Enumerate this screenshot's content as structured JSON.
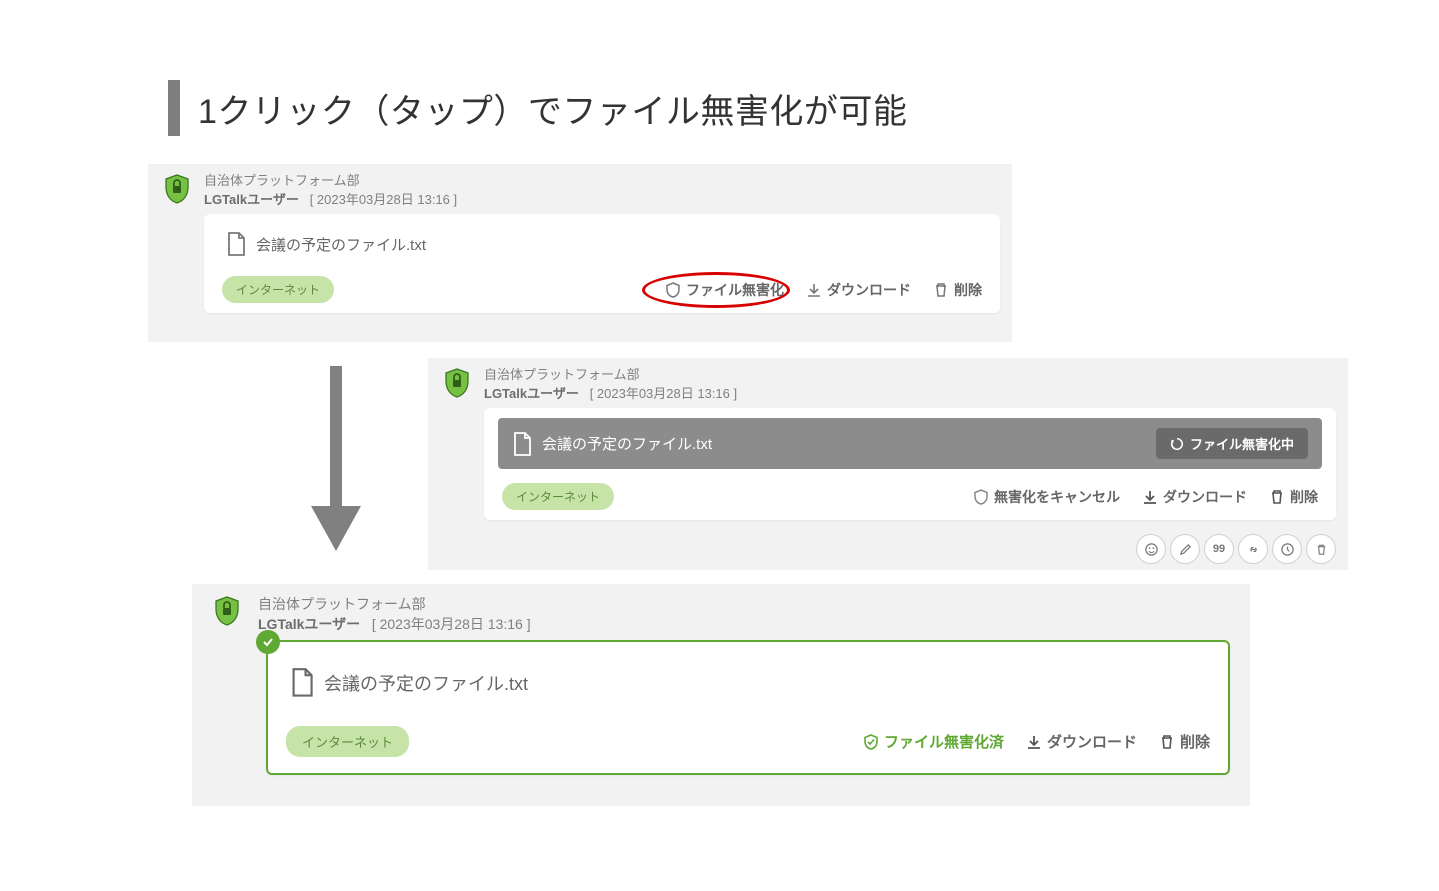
{
  "heading": "1クリック（タップ）でファイル無害化が可能",
  "dept": "自治体プラットフォーム部",
  "user": "LGTalkユーザー",
  "timestamp": "[ 2023年03月28日 13:16 ]",
  "filename": "会議の予定のファイル.txt",
  "badge": "インターネット",
  "actions": {
    "sanitize": "ファイル無害化",
    "download": "ダウンロード",
    "delete": "削除",
    "sanitizing": "ファイル無害化中",
    "cancel_sanitize": "無害化をキャンセル",
    "sanitized": "ファイル無害化済"
  }
}
